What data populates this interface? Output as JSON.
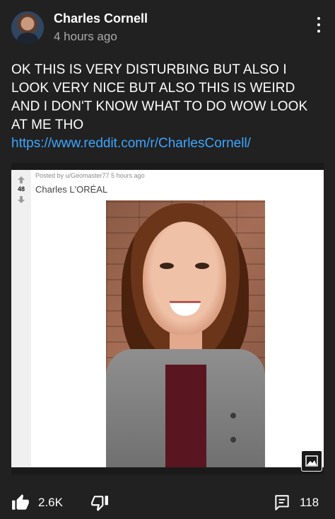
{
  "post": {
    "author": "Charles Cornell",
    "time": "4 hours ago",
    "text": "OK THIS IS VERY DISTURBING BUT ALSO I LOOK VERY NICE BUT ALSO THIS IS WEIRD AND I DON'T KNOW WHAT TO DO WOW LOOK AT ME THO",
    "link": "https://www.reddit.com/r/CharlesCornell/"
  },
  "embed": {
    "posted_by": "Posted by u/Geomaster77 5 hours ago",
    "vote_count": "48",
    "title": "Charles L'ORÉAL"
  },
  "actions": {
    "likes": "2.6K",
    "comments": "118"
  },
  "colors": {
    "background": "#212121",
    "link": "#3ea6ff"
  },
  "icons": [
    "more-vert-icon",
    "upvote-icon",
    "downvote-icon",
    "image-icon",
    "thumbs-up-icon",
    "thumbs-down-icon",
    "comment-icon"
  ]
}
